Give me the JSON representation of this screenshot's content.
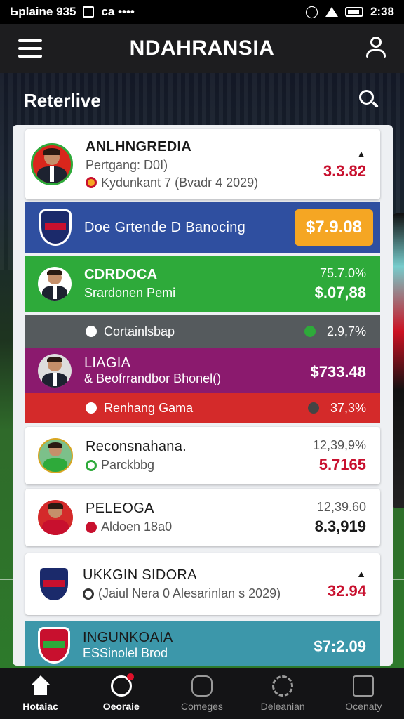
{
  "status_bar": {
    "left_text": "Ьplaine 935",
    "left_extra": "ca ••••",
    "time": "2:38"
  },
  "header": {
    "title": "NDAHRANSIA"
  },
  "section": {
    "title": "Reterlive"
  },
  "rows": [
    {
      "name": "ANLHNGREDIA",
      "line1": "Pertgang: D0I)",
      "line2": "Kydunkant 7 (Bvadr 4 2029)",
      "value": "3.3.82",
      "marker": "▲"
    },
    {
      "name": "Doe Grtende D Banocing",
      "badge": "$7.9.08"
    },
    {
      "name": "CDRDOCA",
      "sub": "Srardonen Pemi",
      "v1": "75.7.0%",
      "v2": "$.07,88"
    },
    {
      "name": "Cortainlsbap",
      "value": "2.9,7%"
    },
    {
      "name": "LIAGIA",
      "sub": "& Beofrrandbor Bhonel()",
      "value": "$733.48"
    },
    {
      "name": "Renhang Gama",
      "value": "37,3%"
    },
    {
      "name": "Reconsnahana.",
      "sub": "Parckbbg",
      "v1": "12,39,9%",
      "v2": "5.7165"
    },
    {
      "name": "PELEOGA",
      "sub": "Aldoen 18a0",
      "v1": "12,39.60",
      "v2": "8.3,919"
    },
    {
      "name": "UKKGIN SIDORA",
      "sub": "(Jaiul Nera 0 Alesarinlan s 2029)",
      "value": "32.94",
      "marker": "▲"
    },
    {
      "name": "INGUNKOAIA",
      "sub": "ESSinolel Brod",
      "value": "$7:2.09"
    }
  ],
  "nav": [
    {
      "label": "Hotaiac"
    },
    {
      "label": "Oeoraie"
    },
    {
      "label": "Comeges"
    },
    {
      "label": "Deleanian"
    },
    {
      "label": "Ocenaty"
    }
  ],
  "colors": {
    "blue": "#2f4fa0",
    "green": "#2eaa3a",
    "gray": "#555a5d",
    "purple": "#8b1a6e",
    "red": "#d42a2a",
    "teal": "#3c97aa",
    "orange": "#f5a623"
  }
}
